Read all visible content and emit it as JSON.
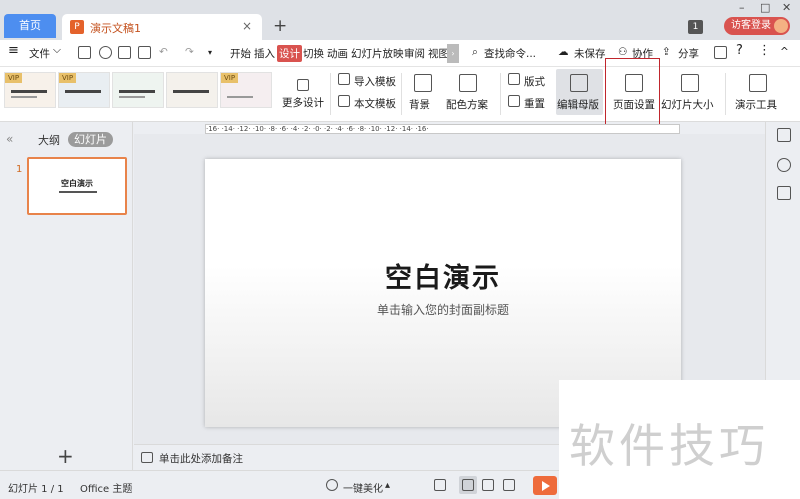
{
  "titlebar": {
    "home_tab": "首页",
    "doc_tab": "演示文稿1",
    "doc_close": "×",
    "new_tab": "+",
    "window_badge": "1",
    "login_button": "访客登录",
    "win_min": "–",
    "win_max": "□",
    "win_close": "✕"
  },
  "menubar": {
    "file_menu": "文件",
    "file_arrow": "⌵",
    "tabs": [
      "开始",
      "插入",
      "设计",
      "切换",
      "动画",
      "幻灯片放映",
      "审阅",
      "视图"
    ],
    "active_tab": "设计",
    "more_arrow": "›",
    "search": "查找命令...",
    "unsaved": "未保存",
    "collaborate": "协作",
    "share": "分享",
    "help": "?",
    "more": "⋮",
    "collapse": "^"
  },
  "ribbon": {
    "templates": [
      {
        "badge": "VIP"
      },
      {
        "badge": "VIP"
      },
      {
        "badge": ""
      },
      {
        "badge": ""
      },
      {
        "badge": "VIP"
      }
    ],
    "more_designs": "更多设计",
    "import_template": "导入模板",
    "text_template": "本文模板",
    "background": "背景",
    "color_scheme": "配色方案",
    "layout": "版式",
    "reset": "重置",
    "edit_master": "编辑母版",
    "page_setup": "页面设置",
    "slide_size": "幻灯片大小",
    "presentation_tools": "演示工具"
  },
  "leftpanel": {
    "collapse": "«",
    "outline_tab": "大纲",
    "slides_tab": "幻灯片",
    "thumb_number": "1",
    "thumb_title": "空白演示",
    "add_slide": "+"
  },
  "ruler": {
    "text": "·16· ·14· ·12· ·10· ·8· ·6· ·4· ·2· ·0· ·2· ·4· ·6· ·8· ·10· ·12· ·14· ·16·"
  },
  "slide": {
    "title": "空白演示",
    "subtitle": "单击输入您的封面副标题"
  },
  "notes": {
    "placeholder": "单击此处添加备注"
  },
  "statusbar": {
    "slide_counter": "幻灯片 1 / 1",
    "theme": "Office 主题",
    "beautify": "一键美化",
    "beautify_arrow": "▴"
  },
  "watermark": {
    "text": "软件技巧"
  }
}
